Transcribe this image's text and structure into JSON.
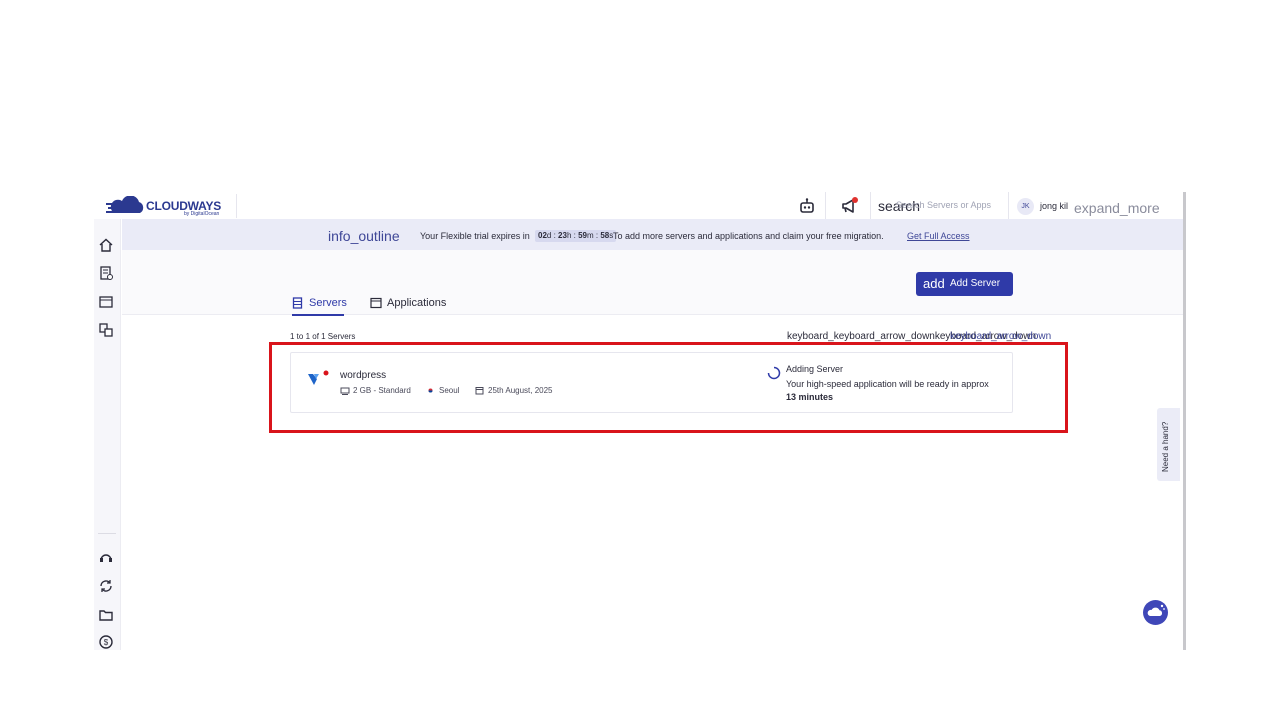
{
  "brand": {
    "name": "CLOUDWAYS",
    "sub": "by DigitalOcean"
  },
  "topbar": {
    "search_ligature": "search",
    "search_placeholder": "Search Servers or Apps",
    "user_initials": "JK",
    "user_name": "jong kil",
    "expand_ligature": "expand_more"
  },
  "banner": {
    "info_ligature": "info_outline",
    "text_before_timer": "Your Flexible trial expires in",
    "timer": {
      "days": "02",
      "d": "d",
      "hours": "23",
      "h": "h",
      "minutes": "59",
      "m": "m",
      "seconds": "58",
      "s": "s"
    },
    "text_after_timer": "To add more servers and applications and claim your free migration.",
    "link": "Get Full Access"
  },
  "actions": {
    "add_ligature": "add",
    "add_server": "Add Server"
  },
  "tabs": [
    {
      "label": "Servers",
      "active": true
    },
    {
      "label": "Applications",
      "active": false
    }
  ],
  "list": {
    "count": "1 to 1 of 1 Servers",
    "sort_ligatures": "keyboard_keyboard_arrow_downkeyboard_arrow_down",
    "sort_ligatures_link": "keyboard_arrow_down"
  },
  "server": {
    "name": "wordpress",
    "size": "2 GB - Standard",
    "location": "Seoul",
    "date": "25th August, 2025",
    "status_title": "Adding Server",
    "status_message": "Your high-speed application will be ready in approx",
    "eta": "13 minutes"
  },
  "help": {
    "label": "Need a hand?"
  },
  "colors": {
    "primary": "#2f3aa8",
    "highlight": "#d9141b",
    "banner_bg": "#eaebf7"
  }
}
